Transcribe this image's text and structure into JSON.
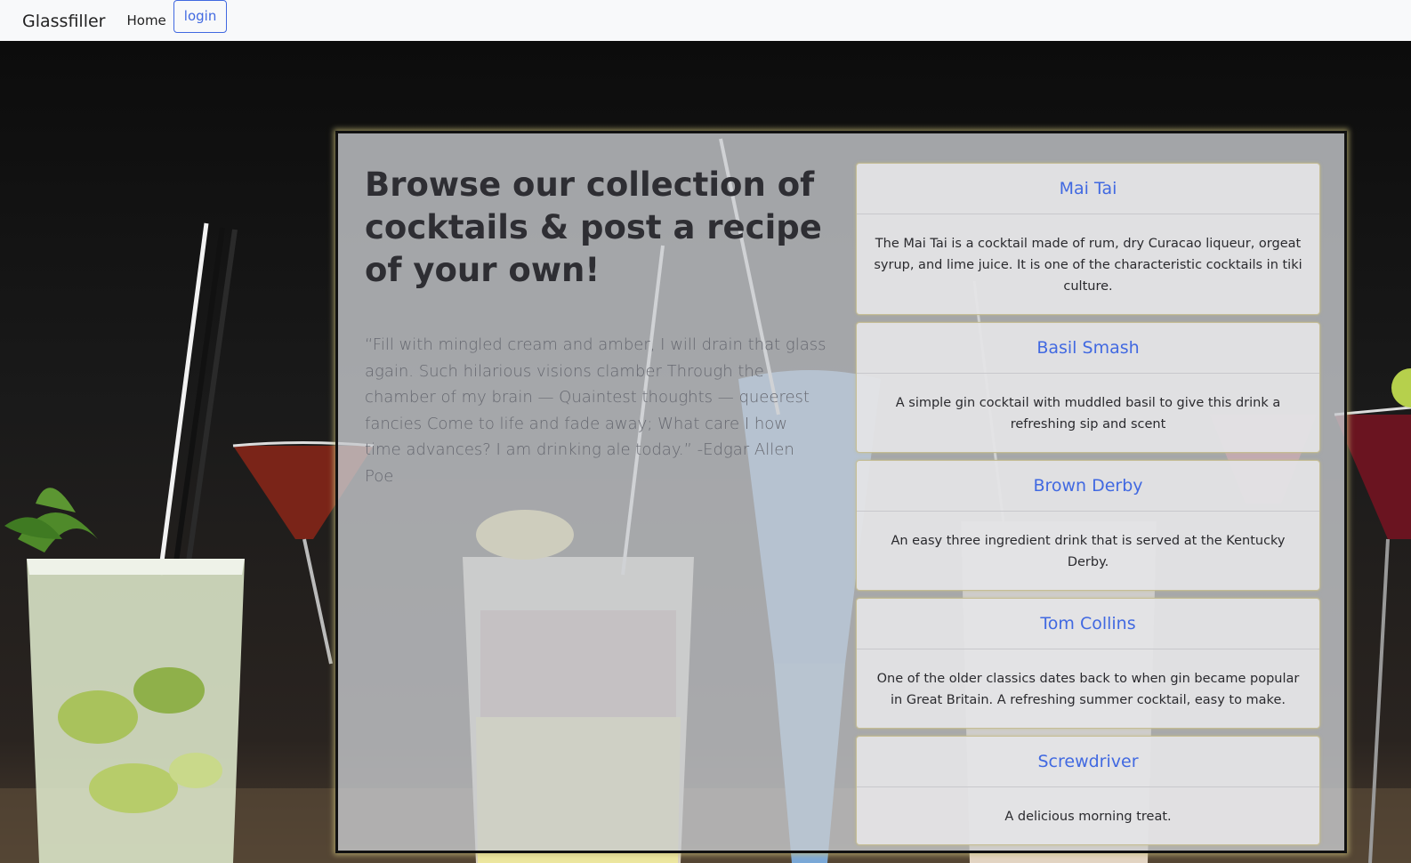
{
  "navbar": {
    "brand": "Glassfiller",
    "home_label": "Home",
    "login_label": "login"
  },
  "hero": {
    "headline": "Browse our collection of cocktails & post a recipe of your own!",
    "quote": "“Fill with mingled cream and amber, I will drain that glass again. Such hilarious visions clamber Through the chamber of my brain — Quaintest thoughts — queerest fancies Come to life and fade away; What care I how time advances? I am drinking ale today.” -Edgar Allen Poe"
  },
  "cocktails": [
    {
      "name": "Mai Tai",
      "description": "The Mai Tai is a cocktail made of rum, dry Curacao liqueur, orgeat syrup, and lime juice. It is one of the characteristic cocktails in tiki culture."
    },
    {
      "name": "Basil Smash",
      "description": "A simple gin cocktail with muddled basil to give this drink a refreshing sip and scent"
    },
    {
      "name": "Brown Derby",
      "description": "An easy three ingredient drink that is served at the Kentucky Derby."
    },
    {
      "name": "Tom Collins",
      "description": "One of the older classics dates back to when gin became popular in Great Britain. A refreshing summer cocktail, easy to make."
    },
    {
      "name": "Screwdriver",
      "description": "A delicious morning treat."
    }
  ],
  "colors": {
    "link": "#4169e1",
    "navbar_bg": "#f8f9fa"
  }
}
